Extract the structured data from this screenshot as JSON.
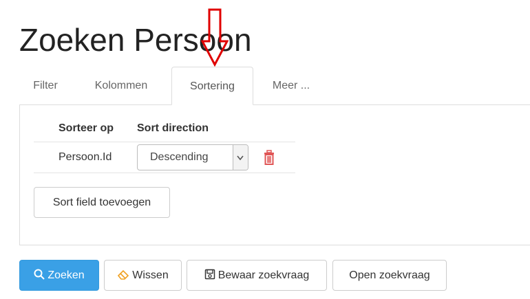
{
  "page": {
    "title": "Zoeken Persoon"
  },
  "tabs": [
    {
      "label": "Filter",
      "active": false
    },
    {
      "label": "Kolommen",
      "active": false
    },
    {
      "label": "Sortering",
      "active": true
    },
    {
      "label": "Meer ...",
      "active": false
    }
  ],
  "sort": {
    "headers": {
      "field": "Sorteer op",
      "direction": "Sort direction"
    },
    "rows": [
      {
        "field": "Persoon.Id",
        "direction": "Descending"
      }
    ],
    "add_label": "Sort field toevoegen"
  },
  "actions": {
    "search_label": "Zoeken",
    "clear_label": "Wissen",
    "save_label": "Bewaar zoekvraag",
    "open_label": "Open zoekvraag"
  },
  "colors": {
    "primary": "#3aa0e6",
    "delete": "#e05555",
    "annotation": "#e00000"
  },
  "icons": [
    "search-icon",
    "eraser-icon",
    "save-icon",
    "trash-icon",
    "chevron-down-icon",
    "annotation-arrow"
  ]
}
